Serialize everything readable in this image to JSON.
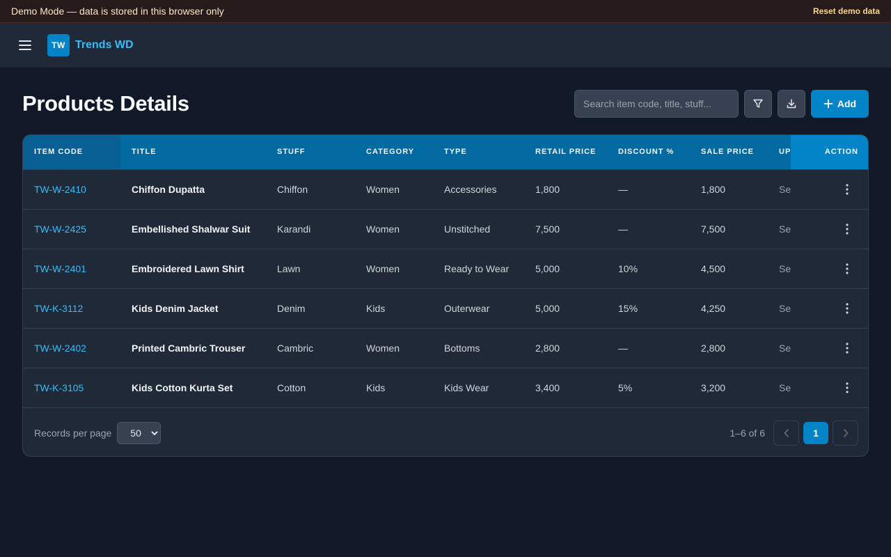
{
  "banner": {
    "text": "Demo Mode — data is stored in this browser only",
    "reset_label": "Reset demo data"
  },
  "header": {
    "logo_initials": "TW",
    "brand": "Trends WD",
    "menu_icon": "hamburger-menu-icon"
  },
  "page": {
    "title": "Products Details",
    "search_placeholder": "Search item code, title, stuff...",
    "filter_icon": "funnel-icon",
    "download_icon": "download-icon",
    "add_label": "Add"
  },
  "table": {
    "columns": [
      "ITEM CODE",
      "TITLE",
      "STUFF",
      "CATEGORY",
      "TYPE",
      "RETAIL PRICE",
      "DISCOUNT %",
      "SALE PRICE",
      "UP",
      "ACTION"
    ],
    "rows": [
      {
        "code": "TW-W-2410",
        "title": "Chiffon Dupatta",
        "stuff": "Chiffon",
        "category": "Women",
        "type": "Accessories",
        "retail": "1,800",
        "discount": "—",
        "sale": "1,800",
        "up": "Se"
      },
      {
        "code": "TW-W-2425",
        "title": "Embellished Shalwar Suit",
        "stuff": "Karandi",
        "category": "Women",
        "type": "Unstitched",
        "retail": "7,500",
        "discount": "—",
        "sale": "7,500",
        "up": "Se"
      },
      {
        "code": "TW-W-2401",
        "title": "Embroidered Lawn Shirt",
        "stuff": "Lawn",
        "category": "Women",
        "type": "Ready to Wear",
        "retail": "5,000",
        "discount": "10%",
        "sale": "4,500",
        "up": "Se"
      },
      {
        "code": "TW-K-3112",
        "title": "Kids Denim Jacket",
        "stuff": "Denim",
        "category": "Kids",
        "type": "Outerwear",
        "retail": "5,000",
        "discount": "15%",
        "sale": "4,250",
        "up": "Se"
      },
      {
        "code": "TW-W-2402",
        "title": "Printed Cambric Trouser",
        "stuff": "Cambric",
        "category": "Women",
        "type": "Bottoms",
        "retail": "2,800",
        "discount": "—",
        "sale": "2,800",
        "up": "Se"
      },
      {
        "code": "TW-K-3105",
        "title": "Kids Cotton Kurta Set",
        "stuff": "Cotton",
        "category": "Kids",
        "type": "Kids Wear",
        "retail": "3,400",
        "discount": "5%",
        "sale": "3,200",
        "up": "Se"
      }
    ]
  },
  "footer": {
    "records_label": "Records per page",
    "records_value": "50",
    "range": "1–6 of 6",
    "current_page": "1",
    "prev_icon": "chevron-left-icon",
    "next_icon": "chevron-right-icon"
  }
}
